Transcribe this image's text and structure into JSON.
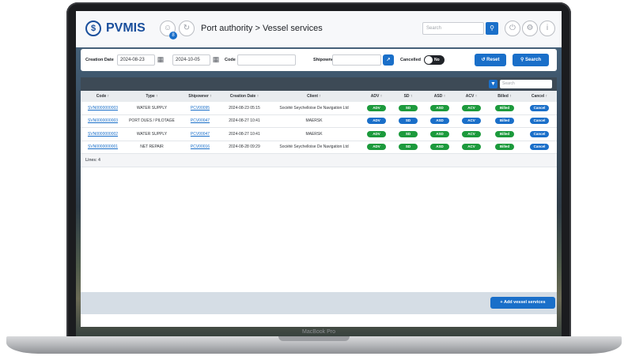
{
  "device": {
    "label": "MacBook Pro"
  },
  "header": {
    "logo_mark": "$",
    "logo_text": "PVMIS",
    "notif_count": "8",
    "breadcrumb": "Port authority > Vessel services",
    "search_placeholder": "Search"
  },
  "filters": {
    "creation_date_label": "Creation Date",
    "date_from": "2024-08-23",
    "date_to": "2024-10-05",
    "code_label": "Code",
    "code_value": "",
    "shipowner_label": "Shipowner",
    "shipowner_value": "",
    "cancelled_label": "Cancelled",
    "cancelled_toggle": "No",
    "reset_label": "Reset",
    "search_label": "Search"
  },
  "table": {
    "search_placeholder": "Search",
    "columns": [
      "Code ↑",
      "Type ↑",
      "Shipowner ↑",
      "Creation Date ↑",
      "Client ↑",
      "ADV ↑",
      "SD ↑",
      "ASD ↑",
      "ACV ↑",
      "Billed ↑",
      "Cancel ↑"
    ],
    "rows": [
      {
        "code": "SVN0000000003",
        "type": "WATER SUPPLY",
        "shipowner": "PCV00095",
        "date": "2024-08-23 05:15",
        "client": "Société Seychelloise De Navigation Ltd",
        "adv": "ADV",
        "sd": "SD",
        "asd": "ASD",
        "acv": "ACV",
        "billed": "Billed",
        "cancel": "Cancel"
      },
      {
        "code": "SVN0000000003",
        "type": "PORT DUES / PILOTAGE",
        "shipowner": "PCV00047",
        "date": "2024-08-27 10:41",
        "client": "MAERSK",
        "adv": "ADV",
        "sd": "SD",
        "asd": "ASD",
        "acv": "ACV",
        "billed": "Billed",
        "cancel": "Cancel"
      },
      {
        "code": "SVN0000000002",
        "type": "WATER SUPPLY",
        "shipowner": "PCV00047",
        "date": "2024-08-27 10:41",
        "client": "MAERSK",
        "adv": "ADV",
        "sd": "SD",
        "asd": "ASD",
        "acv": "ACV",
        "billed": "Billed",
        "cancel": "Cancel"
      },
      {
        "code": "SVN0000000001",
        "type": "NET REPAIR",
        "shipowner": "PCV00016",
        "date": "2024-08-28 09:29",
        "client": "Société Seychelloise De Navigation Ltd",
        "adv": "ADV",
        "sd": "SD",
        "asd": "ASD",
        "acv": "ACV",
        "billed": "Billed",
        "cancel": "Cancel"
      }
    ],
    "lines_label": "Lines: 4",
    "add_button_label": "+ Add vessel services"
  },
  "colors": {
    "primary": "#1a6fc9",
    "success": "#1c9a3c",
    "brand": "#1a4f9c"
  }
}
